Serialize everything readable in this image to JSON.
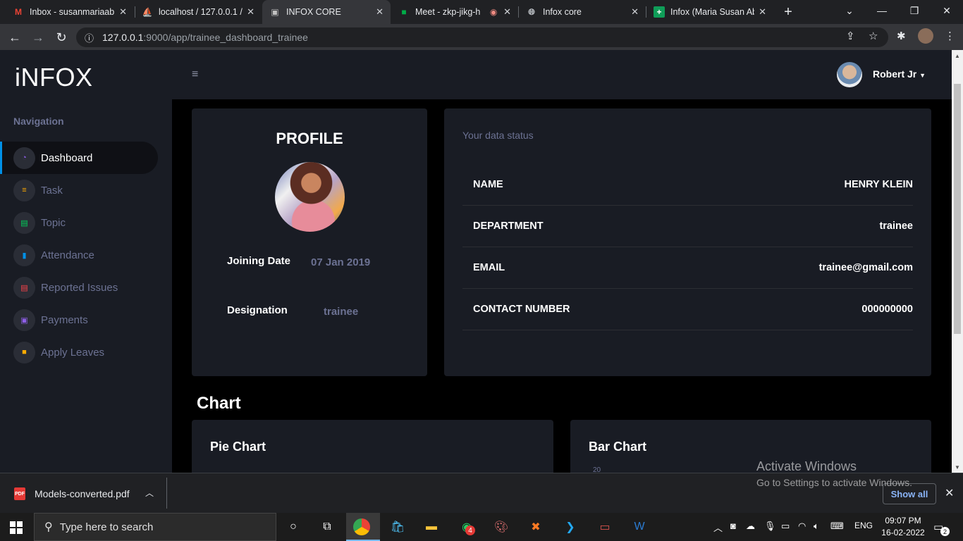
{
  "browser": {
    "tabs": [
      {
        "title": "Inbox - susanmariaab",
        "icon": "gmail-icon"
      },
      {
        "title": "localhost / 127.0.0.1 /",
        "icon": "phpmyadmin-icon"
      },
      {
        "title": "INFOX CORE",
        "icon": "page-icon",
        "active": true
      },
      {
        "title": "Meet - zkp-jikg-h",
        "icon": "meet-icon"
      },
      {
        "title": "Infox core",
        "icon": "globe-icon"
      },
      {
        "title": "Infox (Maria Susan Ab",
        "icon": "sheets-icon"
      }
    ],
    "url_host": "127.0.0.1",
    "url_path": ":9000/app/trainee_dashboard_trainee"
  },
  "app": {
    "logo": "iNFOX",
    "nav_label": "Navigation",
    "nav_items": [
      {
        "label": "Dashboard",
        "icon": "speedometer-icon",
        "color": "#8f5fe8"
      },
      {
        "label": "Task",
        "icon": "list-icon",
        "color": "#ffab00"
      },
      {
        "label": "Topic",
        "icon": "clipboard-icon",
        "color": "#00d25b"
      },
      {
        "label": "Attendance",
        "icon": "bar-chart-icon",
        "color": "#0090e7"
      },
      {
        "label": "Reported Issues",
        "icon": "document-icon",
        "color": "#fc424a"
      },
      {
        "label": "Payments",
        "icon": "card-icon",
        "color": "#8f5fe8"
      },
      {
        "label": "Apply Leaves",
        "icon": "chat-icon",
        "color": "#ffab00"
      }
    ],
    "user_name": "Robert Jr"
  },
  "profile": {
    "title": "PROFILE",
    "joining_label": "Joining Date",
    "joining_value": "07 Jan 2019",
    "designation_label": "Designation",
    "designation_value": "trainee"
  },
  "data_status": {
    "heading": "Your data status",
    "rows": [
      {
        "key": "NAME",
        "value": "HENRY KLEIN"
      },
      {
        "key": "DEPARTMENT",
        "value": "trainee"
      },
      {
        "key": "EMAIL",
        "value": "trainee@gmail.com"
      },
      {
        "key": "CONTACT NUMBER",
        "value": "000000000"
      }
    ]
  },
  "charts": {
    "section_title": "Chart",
    "pie_title": "Pie Chart",
    "bar_title": "Bar Chart",
    "bar_tick": "20"
  },
  "downloads": {
    "file": "Models-converted.pdf",
    "show_all": "Show all"
  },
  "watermark": {
    "line1": "Activate Windows",
    "line2": "Go to Settings to activate Windows."
  },
  "taskbar": {
    "search_placeholder": "Type here to search",
    "whatsapp_badge": "4",
    "lang": "ENG",
    "time": "09:07 PM",
    "date": "16-02-2022",
    "notif_count": "2"
  }
}
